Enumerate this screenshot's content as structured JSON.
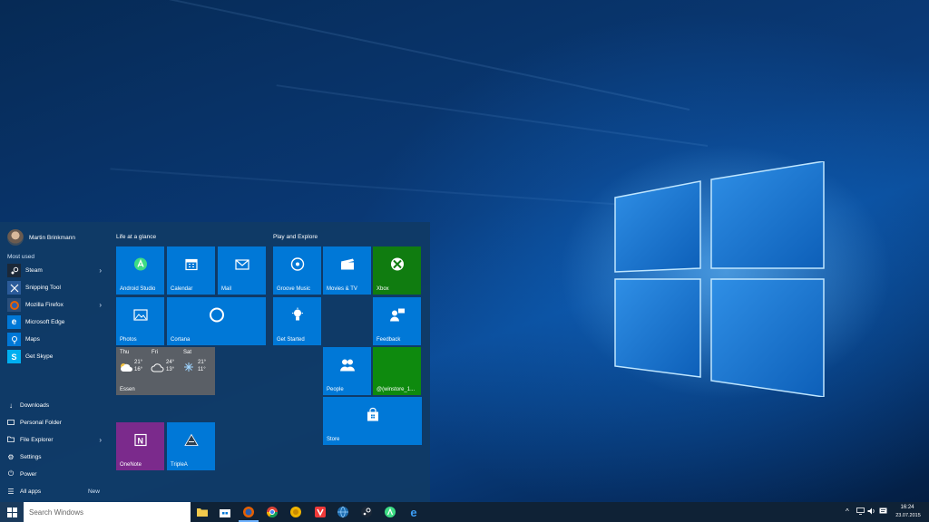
{
  "start_menu": {
    "user": {
      "name": "Martin Brinkmann"
    },
    "most_used_label": "Most used",
    "most_used": [
      {
        "label": "Steam",
        "icon": "steam-icon",
        "has_chevron": true
      },
      {
        "label": "Snipping Tool",
        "icon": "snipping-tool-icon",
        "has_chevron": false
      },
      {
        "label": "Mozilla Firefox",
        "icon": "firefox-icon",
        "has_chevron": true
      },
      {
        "label": "Microsoft Edge",
        "icon": "edge-icon",
        "has_chevron": false
      },
      {
        "label": "Maps",
        "icon": "maps-icon",
        "has_chevron": false
      },
      {
        "label": "Get Skype",
        "icon": "skype-icon",
        "has_chevron": false
      }
    ],
    "system_items": [
      {
        "label": "Downloads",
        "icon": "download-icon"
      },
      {
        "label": "Personal Folder",
        "icon": "folder-icon"
      },
      {
        "label": "File Explorer",
        "icon": "file-explorer-icon"
      },
      {
        "label": "Settings",
        "icon": "gear-icon"
      },
      {
        "label": "Power",
        "icon": "power-icon"
      },
      {
        "label": "All apps",
        "icon": "all-apps-icon"
      }
    ],
    "all_apps_badge": "New",
    "groups": {
      "left_title": "Life at a glance",
      "right_title": "Play and Explore"
    },
    "tiles": {
      "android_studio": "Android Studio",
      "calendar": "Calendar",
      "mail": "Mail",
      "photos": "Photos",
      "cortana": "Cortana",
      "onenote": "OneNote",
      "triplea": "TripleA",
      "groove": "Groove Music",
      "movies": "Movies & TV",
      "xbox": "Xbox",
      "get_started": "Get Started",
      "feedback": "Feedback",
      "people": "People",
      "winstore": "@(winstore_1...",
      "store": "Store"
    },
    "weather": {
      "city": "Essen",
      "days": [
        {
          "day": "Thu",
          "high": "21°",
          "low": "16°"
        },
        {
          "day": "Fri",
          "high": "24°",
          "low": "13°"
        },
        {
          "day": "Sat",
          "high": "21°",
          "low": "11°"
        }
      ]
    }
  },
  "taskbar": {
    "search_placeholder": "Search Windows",
    "time": "16:24",
    "date": "23.07.2015"
  },
  "colors": {
    "accent": "#0078d7",
    "xbox_green": "#107c10",
    "onenote_purple": "#7b2a8c"
  }
}
